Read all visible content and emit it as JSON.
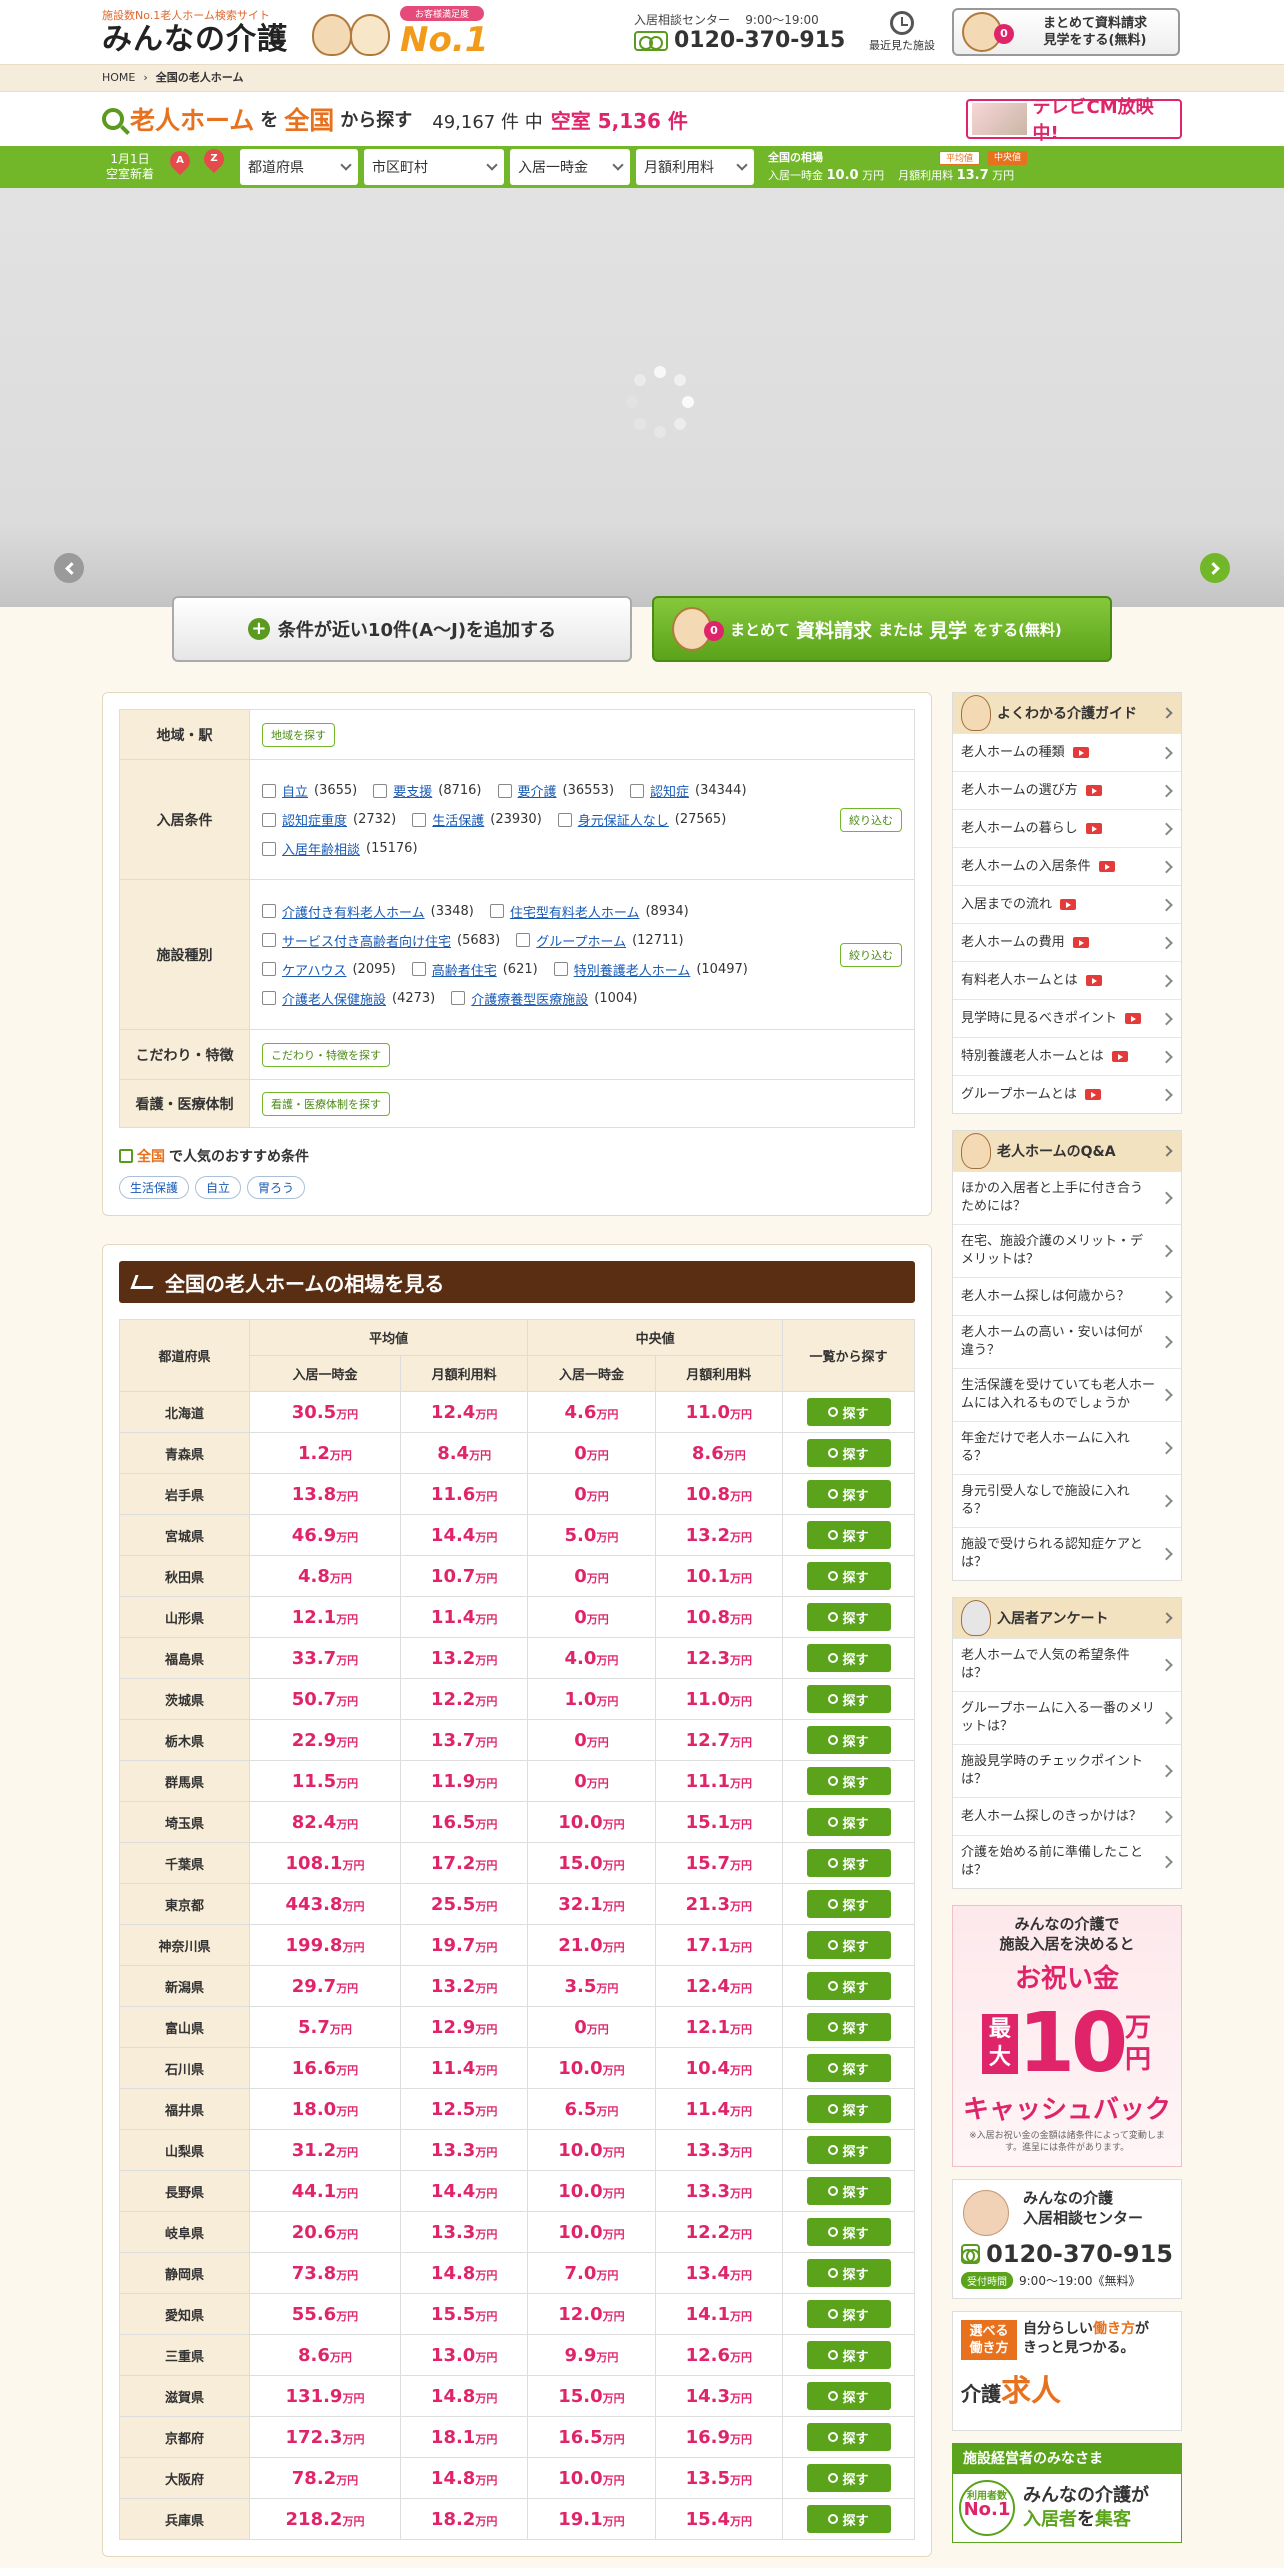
{
  "header": {
    "tagline": "施設数No.1老人ホーム検索サイト",
    "logo": "みんなの介護",
    "rank_ribbon": "お客様満足度",
    "rank_no1": "No.1",
    "contact_center": "入居相談センター",
    "contact_hours": "9:00〜19:00",
    "phone": "0120-370-915",
    "recent_label": "最近見た施設",
    "request_button": "まとめて資料請求\n見学をする(無料)",
    "request_count": "0"
  },
  "breadcrumb": {
    "home": "HOME",
    "current": "全国の老人ホーム"
  },
  "search_title": {
    "keyword": "老人ホーム",
    "wo": "を",
    "region": "全国",
    "kara": "から探す",
    "total": "49,167 件 中",
    "vacancy": "空室 5,136 件",
    "tvcm": "テレビCM放映中!"
  },
  "filter_bar": {
    "date": "1月1日",
    "new_label": "空室新着",
    "pin_a": "A",
    "pin_z": "Z",
    "pref": "都道府県",
    "city": "市区町村",
    "entry_fee": "入居一時金",
    "monthly": "月額利用料",
    "market_title": "全国の相場",
    "tag_avg": "平均値",
    "tag_med": "中央値",
    "entry_label": "入居一時金",
    "entry_value": "10.0",
    "monthly_label": "月額利用料",
    "monthly_value": "13.7",
    "unit": "万円"
  },
  "actions": {
    "add_similar": "条件が近い10件(A〜J)を追加する",
    "request_pre": "まとめて",
    "request_big": "資料請求",
    "request_mid": "または",
    "request_big2": "見学",
    "request_post": "をする(無料)",
    "count": "0"
  },
  "filter": {
    "area_label": "地域・駅",
    "area_button": "地域を探す",
    "cond_label": "入居条件",
    "conditions": [
      {
        "name": "自立",
        "count": "(3655)"
      },
      {
        "name": "要支援",
        "count": "(8716)"
      },
      {
        "name": "要介護",
        "count": "(36553)"
      },
      {
        "name": "認知症",
        "count": "(34344)"
      },
      {
        "name": "認知症重度",
        "count": "(2732)"
      },
      {
        "name": "生活保護",
        "count": "(23930)"
      },
      {
        "name": "身元保証人なし",
        "count": "(27565)"
      },
      {
        "name": "入居年齢相談",
        "count": "(15176)"
      }
    ],
    "type_label": "施設種別",
    "types": [
      {
        "name": "介護付き有料老人ホーム",
        "count": "(3348)"
      },
      {
        "name": "住宅型有料老人ホーム",
        "count": "(8934)"
      },
      {
        "name": "サービス付き高齢者向け住宅",
        "count": "(5683)"
      },
      {
        "name": "グループホーム",
        "count": "(12711)"
      },
      {
        "name": "ケアハウス",
        "count": "(2095)"
      },
      {
        "name": "高齢者住宅",
        "count": "(621)"
      },
      {
        "name": "特別養護老人ホーム",
        "count": "(10497)"
      },
      {
        "name": "介護老人保健施設",
        "count": "(4273)"
      },
      {
        "name": "介護療養型医療施設",
        "count": "(1004)"
      }
    ],
    "narrow_button": "絞り込む",
    "feature_label": "こだわり・特徴",
    "feature_button": "こだわり・特徴を探す",
    "medical_label": "看護・医療体制",
    "medical_button": "看護・医療体制を探す",
    "rec_region": "全国",
    "rec_suffix": "で人気のおすすめ条件",
    "rec_tags": [
      "生活保護",
      "自立",
      "胃ろう"
    ]
  },
  "prices": {
    "title": "全国の老人ホームの相場を見る",
    "col_pref": "都道府県",
    "col_avg": "平均値",
    "col_med": "中央値",
    "col_entry": "入居一時金",
    "col_monthly": "月額利用料",
    "col_find": "一覧から探す",
    "find_label": "探す",
    "unit": "万円",
    "rows": [
      {
        "pref": "北海道",
        "ae": "30.5",
        "am": "12.4",
        "me": "4.6",
        "mm": "11.0"
      },
      {
        "pref": "青森県",
        "ae": "1.2",
        "am": "8.4",
        "me": "0",
        "mm": "8.6"
      },
      {
        "pref": "岩手県",
        "ae": "13.8",
        "am": "11.6",
        "me": "0",
        "mm": "10.8"
      },
      {
        "pref": "宮城県",
        "ae": "46.9",
        "am": "14.4",
        "me": "5.0",
        "mm": "13.2"
      },
      {
        "pref": "秋田県",
        "ae": "4.8",
        "am": "10.7",
        "me": "0",
        "mm": "10.1"
      },
      {
        "pref": "山形県",
        "ae": "12.1",
        "am": "11.4",
        "me": "0",
        "mm": "10.8"
      },
      {
        "pref": "福島県",
        "ae": "33.7",
        "am": "13.2",
        "me": "4.0",
        "mm": "12.3"
      },
      {
        "pref": "茨城県",
        "ae": "50.7",
        "am": "12.2",
        "me": "1.0",
        "mm": "11.0"
      },
      {
        "pref": "栃木県",
        "ae": "22.9",
        "am": "13.7",
        "me": "0",
        "mm": "12.7"
      },
      {
        "pref": "群馬県",
        "ae": "11.5",
        "am": "11.9",
        "me": "0",
        "mm": "11.1"
      },
      {
        "pref": "埼玉県",
        "ae": "82.4",
        "am": "16.5",
        "me": "10.0",
        "mm": "15.1"
      },
      {
        "pref": "千葉県",
        "ae": "108.1",
        "am": "17.2",
        "me": "15.0",
        "mm": "15.7"
      },
      {
        "pref": "東京都",
        "ae": "443.8",
        "am": "25.5",
        "me": "32.1",
        "mm": "21.3"
      },
      {
        "pref": "神奈川県",
        "ae": "199.8",
        "am": "19.7",
        "me": "21.0",
        "mm": "17.1"
      },
      {
        "pref": "新潟県",
        "ae": "29.7",
        "am": "13.2",
        "me": "3.5",
        "mm": "12.4"
      },
      {
        "pref": "富山県",
        "ae": "5.7",
        "am": "12.9",
        "me": "0",
        "mm": "12.1"
      },
      {
        "pref": "石川県",
        "ae": "16.6",
        "am": "11.4",
        "me": "10.0",
        "mm": "10.4"
      },
      {
        "pref": "福井県",
        "ae": "18.0",
        "am": "12.5",
        "me": "6.5",
        "mm": "11.4"
      },
      {
        "pref": "山梨県",
        "ae": "31.2",
        "am": "13.3",
        "me": "10.0",
        "mm": "13.3"
      },
      {
        "pref": "長野県",
        "ae": "44.1",
        "am": "14.4",
        "me": "10.0",
        "mm": "13.3"
      },
      {
        "pref": "岐阜県",
        "ae": "20.6",
        "am": "13.3",
        "me": "10.0",
        "mm": "12.2"
      },
      {
        "pref": "静岡県",
        "ae": "73.8",
        "am": "14.8",
        "me": "7.0",
        "mm": "13.4"
      },
      {
        "pref": "愛知県",
        "ae": "55.6",
        "am": "15.5",
        "me": "12.0",
        "mm": "14.1"
      },
      {
        "pref": "三重県",
        "ae": "8.6",
        "am": "13.0",
        "me": "9.9",
        "mm": "12.6"
      },
      {
        "pref": "滋賀県",
        "ae": "131.9",
        "am": "14.8",
        "me": "15.0",
        "mm": "14.3"
      },
      {
        "pref": "京都府",
        "ae": "172.3",
        "am": "18.1",
        "me": "16.5",
        "mm": "16.9"
      },
      {
        "pref": "大阪府",
        "ae": "78.2",
        "am": "14.8",
        "me": "10.0",
        "mm": "13.5"
      },
      {
        "pref": "兵庫県",
        "ae": "218.2",
        "am": "18.2",
        "me": "19.1",
        "mm": "15.4"
      }
    ]
  },
  "sidebar": {
    "guide_title": "よくわかる介護ガイド",
    "guide_items": [
      {
        "label": "老人ホームの種類",
        "yt": true
      },
      {
        "label": "老人ホームの選び方",
        "yt": true
      },
      {
        "label": "老人ホームの暮らし",
        "yt": true
      },
      {
        "label": "老人ホームの入居条件",
        "yt": true
      },
      {
        "label": "入居までの流れ",
        "yt": true
      },
      {
        "label": "老人ホームの費用",
        "yt": true
      },
      {
        "label": "有料老人ホームとは",
        "yt": true
      },
      {
        "label": "見学時に見るべきポイント",
        "yt": true
      },
      {
        "label": "特別養護老人ホームとは",
        "yt": true
      },
      {
        "label": "グループホームとは",
        "yt": true
      }
    ],
    "qa_title": "老人ホームのQ&A",
    "qa_items": [
      "ほかの入居者と上手に付き合うためには？",
      "在宅、施設介護のメリット・デメリットは？",
      "老人ホーム探しは何歳から？",
      "老人ホームの高い・安いは何が違う？",
      "生活保護を受けていても老人ホームには入れるものでしょうか",
      "年金だけで老人ホームに入れる？",
      "身元引受人なしで施設に入れる？",
      "施設で受けられる認知症ケアとは？"
    ],
    "survey_title": "入居者アンケート",
    "survey_items": [
      "老人ホームで人気の希望条件は？",
      "グループホームに入る一番のメリットは？",
      "施設見学時のチェックポイントは？",
      "老人ホーム探しのきっかけは？",
      "介護を始める前に準備したことは？"
    ],
    "cash": {
      "line1": "みんなの介護で",
      "line2": "施設入居を決めると",
      "gift": "お祝い金",
      "max": "最大",
      "amount": "10",
      "yen": "万円",
      "cashback": "キャッシュバック",
      "note": "※入居お祝い金の金額は諸条件によって変動します。進呈には条件があります。"
    },
    "center": {
      "name1": "みんなの介護",
      "name2": "入居相談センター",
      "phone": "0120-370-915",
      "hours_badge": "受付時間",
      "hours": "9:00〜19:00《無料》"
    },
    "job": {
      "tag": "選べる働き方",
      "copy1": "自分らしい",
      "copy_o": "働き方",
      "copy2": "が",
      "copy3": "きっと見つかる。",
      "brand_pre": "介護",
      "brand": "求人"
    },
    "operator": {
      "title": "施設経営者のみなさま",
      "seal_top": "利用者数",
      "seal_no1": "No.1",
      "text1": "みんなの介護が",
      "text2": "入居者",
      "text3": "を",
      "text4": "集客"
    }
  }
}
